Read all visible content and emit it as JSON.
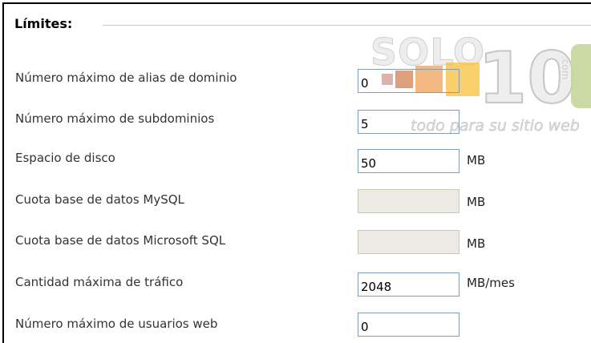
{
  "section": {
    "legend": "Límites:"
  },
  "watermark": {
    "brand_top": "SOLO",
    "brand_number": "10",
    "tagline": "todo para su sitio web",
    "suffix": ".com"
  },
  "colors": {
    "field_border": "#7f9db9",
    "disabled_fill": "#ebebe4",
    "square_1": "#d6a59e",
    "square_2": "#d78e65",
    "square_3": "#f0a25a",
    "square_4": "#fbbf3c",
    "green_mark": "#c5d69a"
  },
  "rows": [
    {
      "label": "Número máximo de alias de dominio",
      "value": "0",
      "unit": "",
      "disabled": false
    },
    {
      "label": "Número máximo de subdominios",
      "value": "5",
      "unit": "",
      "disabled": false
    },
    {
      "label": "Espacio de disco",
      "value": "50",
      "unit": "MB",
      "disabled": false
    },
    {
      "label": "Cuota base de datos MySQL",
      "value": "",
      "unit": "MB",
      "disabled": true
    },
    {
      "label": "Cuota base de datos Microsoft SQL",
      "value": "",
      "unit": "MB",
      "disabled": true
    },
    {
      "label": "Cantidad máxima de tráfico",
      "value": "2048",
      "unit": "MB/mes",
      "disabled": false
    },
    {
      "label": "Número máximo de usuarios web",
      "value": "0",
      "unit": "",
      "disabled": false
    }
  ]
}
